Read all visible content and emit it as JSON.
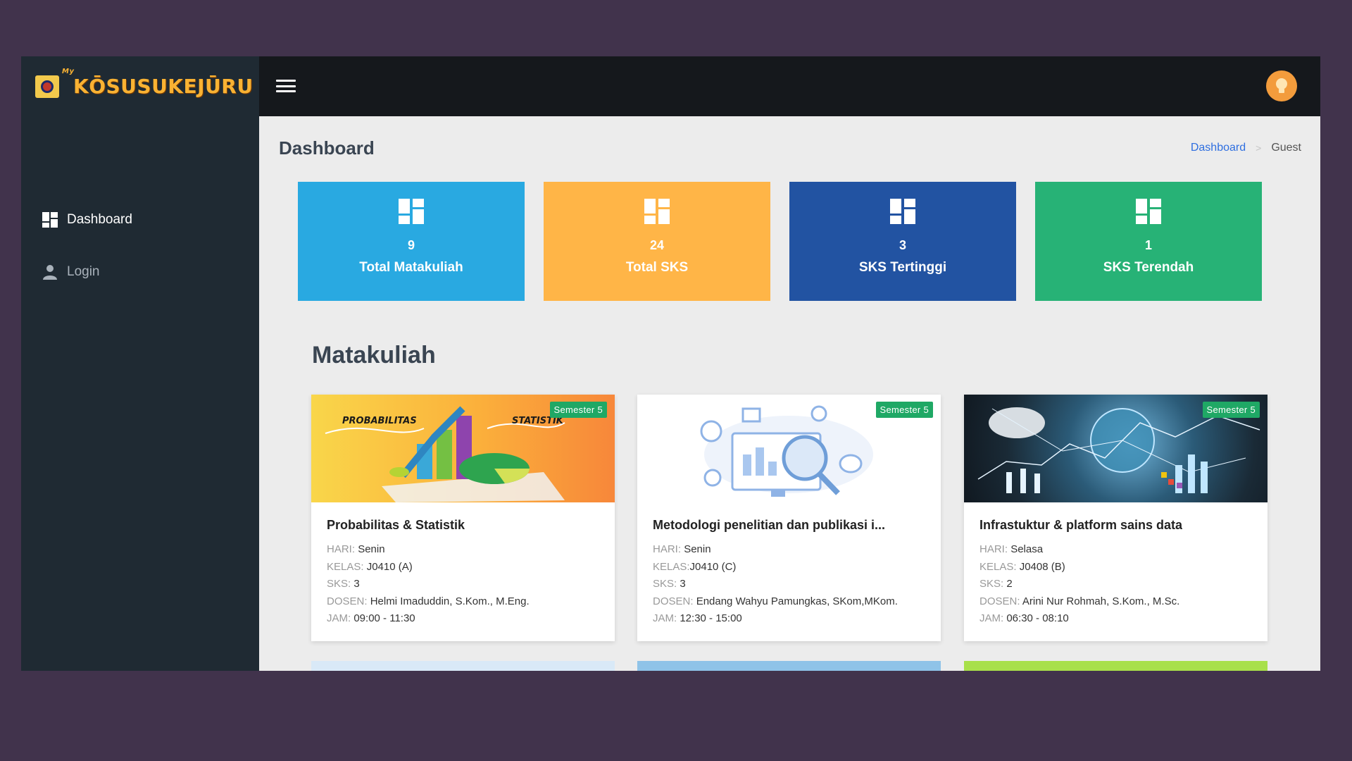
{
  "brand": {
    "superscript": "My",
    "name": "KŌSUSUKEJŪRU"
  },
  "sidebar": {
    "items": [
      {
        "label": "Dashboard",
        "icon": "dashboard-icon",
        "active": true
      },
      {
        "label": "Login",
        "icon": "user-icon",
        "active": false
      }
    ]
  },
  "topbar": {
    "menu_icon": "hamburger-icon",
    "avatar_icon": "lightbulb-icon"
  },
  "page": {
    "title": "Dashboard",
    "breadcrumb": {
      "link": "Dashboard",
      "separator": ">",
      "current": "Guest"
    }
  },
  "stats": [
    {
      "value": "9",
      "label": "Total Matakuliah",
      "color": "#29a9e1"
    },
    {
      "value": "24",
      "label": "Total SKS",
      "color": "#ffb547"
    },
    {
      "value": "3",
      "label": "SKS Tertinggi",
      "color": "#2253a2"
    },
    {
      "value": "1",
      "label": "SKS Terendah",
      "color": "#27b276"
    }
  ],
  "section": {
    "title": "Matakuliah"
  },
  "meta_labels": {
    "hari": "HARI:",
    "kelas_a": "KELAS:",
    "kelas_b": "KELAS:",
    "sks": "SKS:",
    "dosen": "DOSEN:",
    "jam": "JAM:"
  },
  "courses": [
    {
      "badge": "Semester 5",
      "title": "Probabilitas & Statistik",
      "thumb_text_1": "PROBABILITAS",
      "thumb_text_2": "STATISTIK",
      "hari": "Senin",
      "kelas": "J0410 (A)",
      "sks": "3",
      "dosen": "Helmi Imaduddin, S.Kom., M.Eng.",
      "jam": "09:00 - 11:30"
    },
    {
      "badge": "Semester 5",
      "title": "Metodologi penelitian dan publikasi i...",
      "hari": "Senin",
      "kelas": "J0410 (C)",
      "sks": "3",
      "dosen": "Endang Wahyu Pamungkas, SKom,MKom.",
      "jam": "12:30 - 15:00"
    },
    {
      "badge": "Semester 5",
      "title": "Infrastuktur & platform sains data",
      "hari": "Selasa",
      "kelas": "J0408 (B)",
      "sks": "2",
      "dosen": "Arini Nur Rohmah, S.Kom., M.Sc.",
      "jam": "06:30 - 08:10"
    }
  ],
  "colors": {
    "sidebar_bg": "#1f2a33",
    "topbar_bg": "#15181c",
    "content_bg": "#ececec",
    "badge_green": "#1fa865",
    "link_blue": "#2f6fe0"
  }
}
